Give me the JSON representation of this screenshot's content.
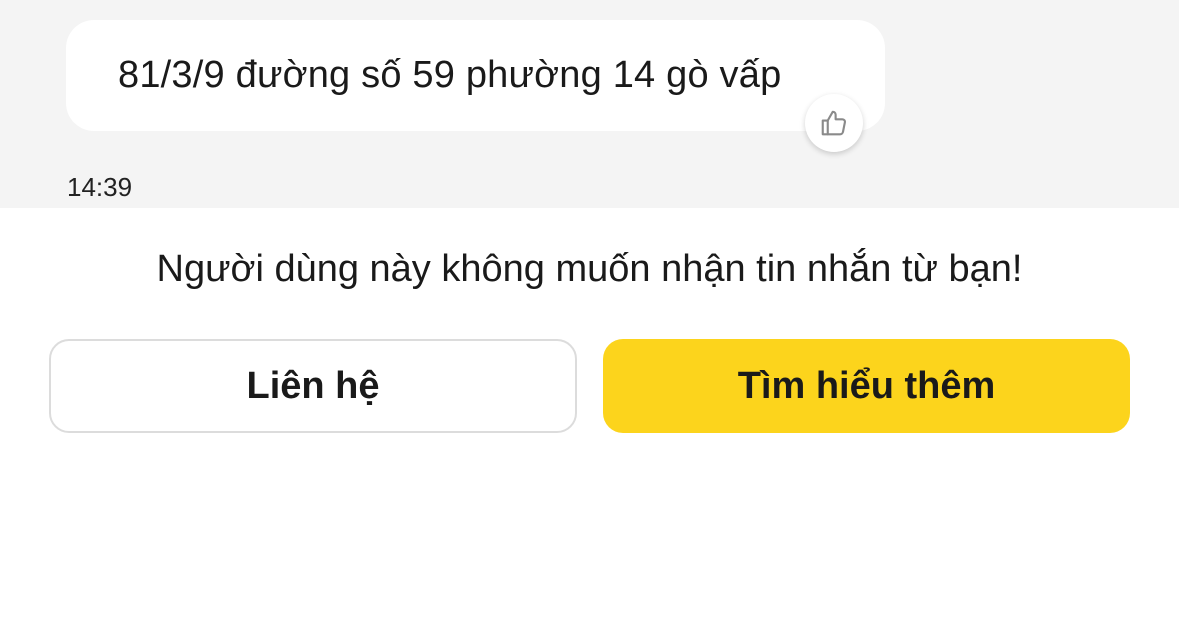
{
  "chat": {
    "message": "81/3/9 đường số 59 phường 14 gò vấp",
    "time": "14:39",
    "reaction_icon": "thumbs-up-icon"
  },
  "notice": {
    "text": "Người dùng này không muốn nhận tin nhắn từ bạn!"
  },
  "actions": {
    "contact_label": "Liên hệ",
    "learn_more_label": "Tìm hiểu thêm"
  },
  "colors": {
    "chat_background": "#f4f4f4",
    "bubble": "#ffffff",
    "primary_button": "#fcd41c",
    "secondary_border": "#dcdcdc"
  }
}
